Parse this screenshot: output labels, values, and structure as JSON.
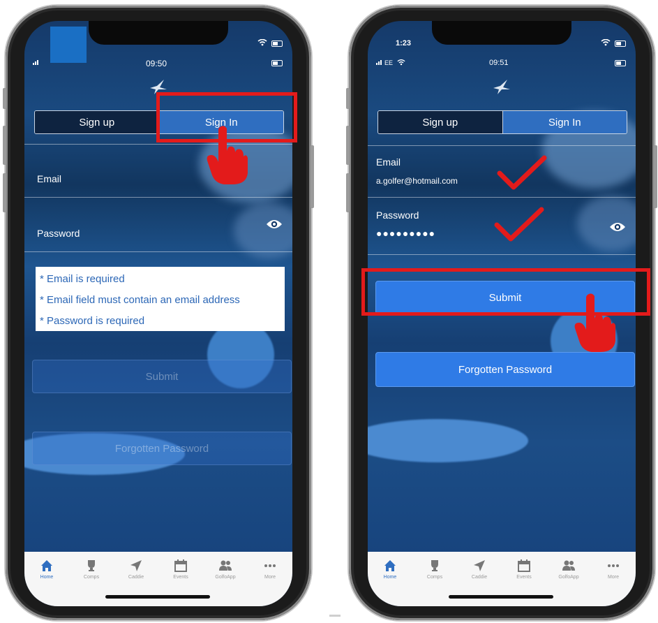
{
  "colors": {
    "accent": "#2f7be6",
    "highlight": "#e31b1b",
    "error_text": "#2c67b6"
  },
  "left_screen": {
    "status": {
      "clock": "09:50"
    },
    "segmented": {
      "signup": "Sign up",
      "signin": "Sign In",
      "selected": "Sign In"
    },
    "email_label": "Email",
    "password_label": "Password",
    "errors": [
      "* Email is required",
      "* Email field must contain an email address",
      "* Password is required"
    ],
    "submit_label": "Submit",
    "forgot_label": "Forgotten Password",
    "tabs": [
      {
        "label": "Home",
        "icon": "home-icon"
      },
      {
        "label": "Comps",
        "icon": "trophy-icon"
      },
      {
        "label": "Caddie",
        "icon": "navigation-arrow-icon"
      },
      {
        "label": "Events",
        "icon": "calendar-icon"
      },
      {
        "label": "GolfoApp",
        "icon": "users-icon"
      },
      {
        "label": "More",
        "icon": "more-icon"
      }
    ]
  },
  "right_screen": {
    "status": {
      "time": "1:23",
      "carrier": "EE",
      "clock": "09:51"
    },
    "segmented": {
      "signup": "Sign up",
      "signin": "Sign In",
      "selected": "Sign In"
    },
    "email_label": "Email",
    "email_value": "a.golfer@hotmail.com",
    "password_label": "Password",
    "password_value": "●●●●●●●●●",
    "submit_label": "Submit",
    "forgot_label": "Forgotten Password",
    "tabs": [
      {
        "label": "Home",
        "icon": "home-icon"
      },
      {
        "label": "Comps",
        "icon": "trophy-icon"
      },
      {
        "label": "Caddie",
        "icon": "navigation-arrow-icon"
      },
      {
        "label": "Events",
        "icon": "calendar-icon"
      },
      {
        "label": "GolfoApp",
        "icon": "users-icon"
      },
      {
        "label": "More",
        "icon": "more-icon"
      }
    ]
  }
}
